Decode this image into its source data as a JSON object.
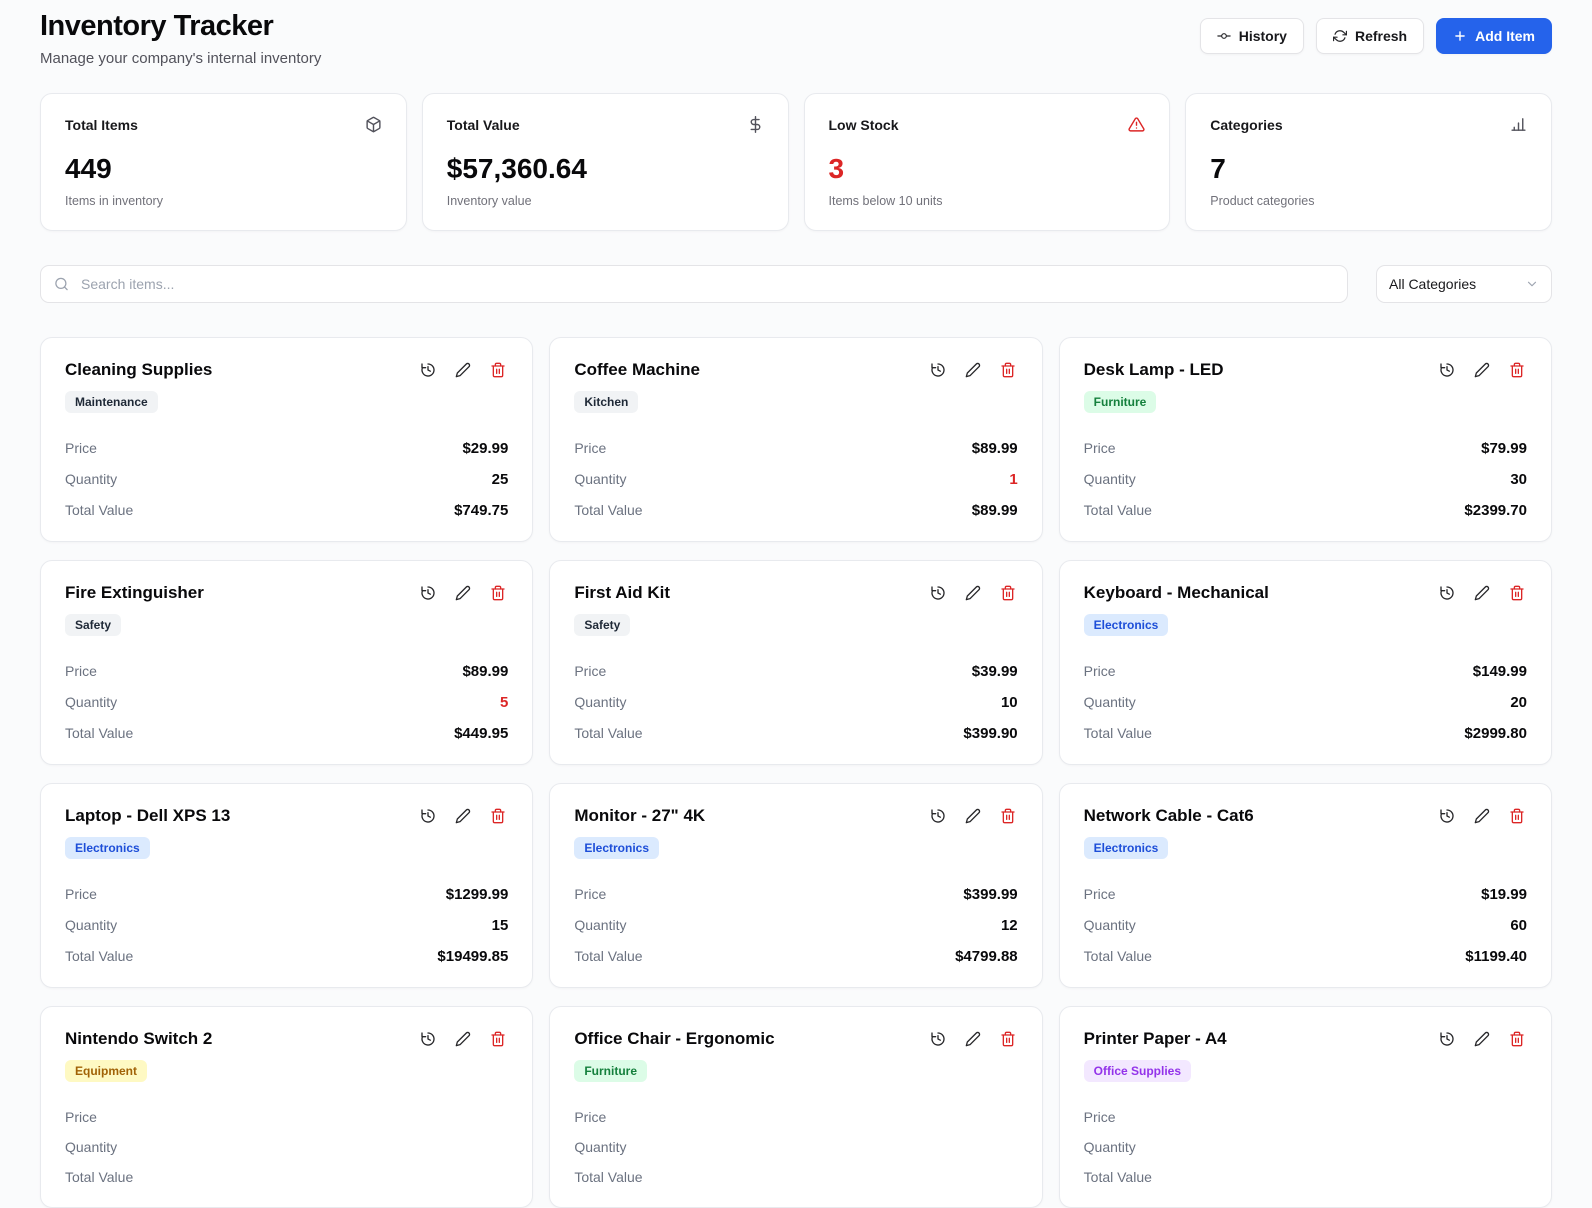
{
  "colors": {
    "primary": "#2563eb",
    "danger": "#dc2626"
  },
  "header": {
    "title": "Inventory Tracker",
    "subtitle": "Manage your company's internal inventory",
    "buttons": {
      "history": "History",
      "refresh": "Refresh",
      "add_item": "Add Item"
    }
  },
  "stats": [
    {
      "label": "Total Items",
      "value": "449",
      "caption": "Items in inventory"
    },
    {
      "label": "Total Value",
      "value": "$57,360.64",
      "caption": "Inventory value"
    },
    {
      "label": "Low Stock",
      "value": "3",
      "caption": "Items below 10 units"
    },
    {
      "label": "Categories",
      "value": "7",
      "caption": "Product categories"
    }
  ],
  "filters": {
    "search_placeholder": "Search items...",
    "category_selected": "All Categories"
  },
  "labels": {
    "price": "Price",
    "quantity": "Quantity",
    "total": "Total Value"
  },
  "items": [
    {
      "name": "Cleaning Supplies",
      "category": "Maintenance",
      "badge_color": "gray",
      "price": "$29.99",
      "quantity": "25",
      "total": "$749.75",
      "qty_class": ""
    },
    {
      "name": "Coffee Machine",
      "category": "Kitchen",
      "badge_color": "gray",
      "price": "$89.99",
      "quantity": "1",
      "total": "$89.99",
      "qty_class": "danger"
    },
    {
      "name": "Desk Lamp - LED",
      "category": "Furniture",
      "badge_color": "green",
      "price": "$79.99",
      "quantity": "30",
      "total": "$2399.70",
      "qty_class": ""
    },
    {
      "name": "Fire Extinguisher",
      "category": "Safety",
      "badge_color": "gray",
      "price": "$89.99",
      "quantity": "5",
      "total": "$449.95",
      "qty_class": "danger"
    },
    {
      "name": "First Aid Kit",
      "category": "Safety",
      "badge_color": "gray",
      "price": "$39.99",
      "quantity": "10",
      "total": "$399.90",
      "qty_class": ""
    },
    {
      "name": "Keyboard - Mechanical",
      "category": "Electronics",
      "badge_color": "blue",
      "price": "$149.99",
      "quantity": "20",
      "total": "$2999.80",
      "qty_class": ""
    },
    {
      "name": "Laptop - Dell XPS 13",
      "category": "Electronics",
      "badge_color": "blue",
      "price": "$1299.99",
      "quantity": "15",
      "total": "$19499.85",
      "qty_class": ""
    },
    {
      "name": "Monitor - 27\" 4K",
      "category": "Electronics",
      "badge_color": "blue",
      "price": "$399.99",
      "quantity": "12",
      "total": "$4799.88",
      "qty_class": ""
    },
    {
      "name": "Network Cable - Cat6",
      "category": "Electronics",
      "badge_color": "blue",
      "price": "$19.99",
      "quantity": "60",
      "total": "$1199.40",
      "qty_class": ""
    },
    {
      "name": "Nintendo Switch 2",
      "category": "Equipment",
      "badge_color": "yellow",
      "price": "",
      "quantity": "",
      "total": "",
      "qty_class": ""
    },
    {
      "name": "Office Chair - Ergonomic",
      "category": "Furniture",
      "badge_color": "green",
      "price": "",
      "quantity": "",
      "total": "",
      "qty_class": ""
    },
    {
      "name": "Printer Paper - A4",
      "category": "Office Supplies",
      "badge_color": "purple",
      "price": "",
      "quantity": "",
      "total": "",
      "qty_class": ""
    }
  ]
}
